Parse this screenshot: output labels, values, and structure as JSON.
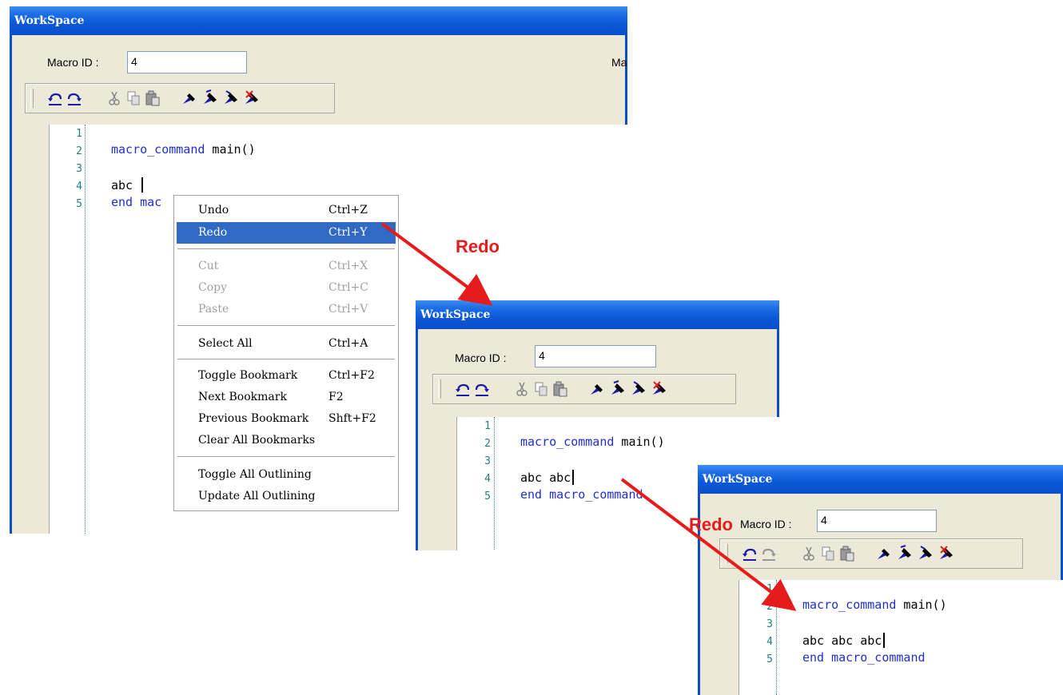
{
  "windows": [
    {
      "title": "WorkSpace",
      "macro_id_label": "Macro ID :",
      "macro_id_value": "4",
      "extra_label": "Ma",
      "lines": [
        {
          "num": "1",
          "keyword": "",
          "text": ""
        },
        {
          "num": "2",
          "keyword": "macro_command",
          "text": " main()"
        },
        {
          "num": "3",
          "keyword": "",
          "text": ""
        },
        {
          "num": "4",
          "keyword": "",
          "text": "abc "
        },
        {
          "num": "5",
          "keyword": "end mac",
          "text": ""
        }
      ]
    },
    {
      "title": "WorkSpace",
      "macro_id_label": "Macro ID :",
      "macro_id_value": "4",
      "lines": [
        {
          "num": "1",
          "keyword": "",
          "text": ""
        },
        {
          "num": "2",
          "keyword": "macro_command",
          "text": " main()"
        },
        {
          "num": "3",
          "keyword": "",
          "text": ""
        },
        {
          "num": "4",
          "keyword": "",
          "text": "abc abc"
        },
        {
          "num": "5",
          "keyword": "end macro_command",
          "text": ""
        }
      ]
    },
    {
      "title": "WorkSpace",
      "macro_id_label": "Macro ID :",
      "macro_id_value": "4",
      "lines": [
        {
          "num": "1",
          "keyword": "",
          "text": ""
        },
        {
          "num": "2",
          "keyword": "macro_command",
          "text": " main()"
        },
        {
          "num": "3",
          "keyword": "",
          "text": ""
        },
        {
          "num": "4",
          "keyword": "",
          "text": "abc abc abc"
        },
        {
          "num": "5",
          "keyword": "end macro_command",
          "text": ""
        }
      ]
    }
  ],
  "toolbar_icons": [
    "undo-icon",
    "redo-icon",
    "cut-icon",
    "copy-icon",
    "paste-icon",
    "toggle-bookmark-icon",
    "next-bookmark-icon",
    "previous-bookmark-icon",
    "clear-bookmarks-icon"
  ],
  "context_menu": {
    "items": [
      {
        "label": "Undo",
        "shortcut": "Ctrl+Z",
        "state": "normal"
      },
      {
        "label": "Redo",
        "shortcut": "Ctrl+Y",
        "state": "selected"
      },
      {
        "label": "Cut",
        "shortcut": "Ctrl+X",
        "state": "disabled"
      },
      {
        "label": "Copy",
        "shortcut": "Ctrl+C",
        "state": "disabled"
      },
      {
        "label": "Paste",
        "shortcut": "Ctrl+V",
        "state": "disabled"
      },
      {
        "label": "Select All",
        "shortcut": "Ctrl+A",
        "state": "normal"
      },
      {
        "label": "Toggle Bookmark",
        "shortcut": "Ctrl+F2",
        "state": "normal"
      },
      {
        "label": "Next Bookmark",
        "shortcut": "F2",
        "state": "normal"
      },
      {
        "label": "Previous Bookmark",
        "shortcut": "Shft+F2",
        "state": "normal"
      },
      {
        "label": "Clear All Bookmarks",
        "shortcut": "",
        "state": "normal"
      },
      {
        "label": "Toggle All Outlining",
        "shortcut": "",
        "state": "normal"
      },
      {
        "label": "Update All Outlining",
        "shortcut": "",
        "state": "normal"
      }
    ]
  },
  "annotations": {
    "redo_1": "Redo",
    "redo_2": "Redo"
  },
  "colors": {
    "titlebar": "#0a58d8",
    "keyword": "#1f2fcf",
    "line_number": "#1f7f7f",
    "menu_highlight": "#316ac5",
    "arrow": "#e61b1b"
  }
}
